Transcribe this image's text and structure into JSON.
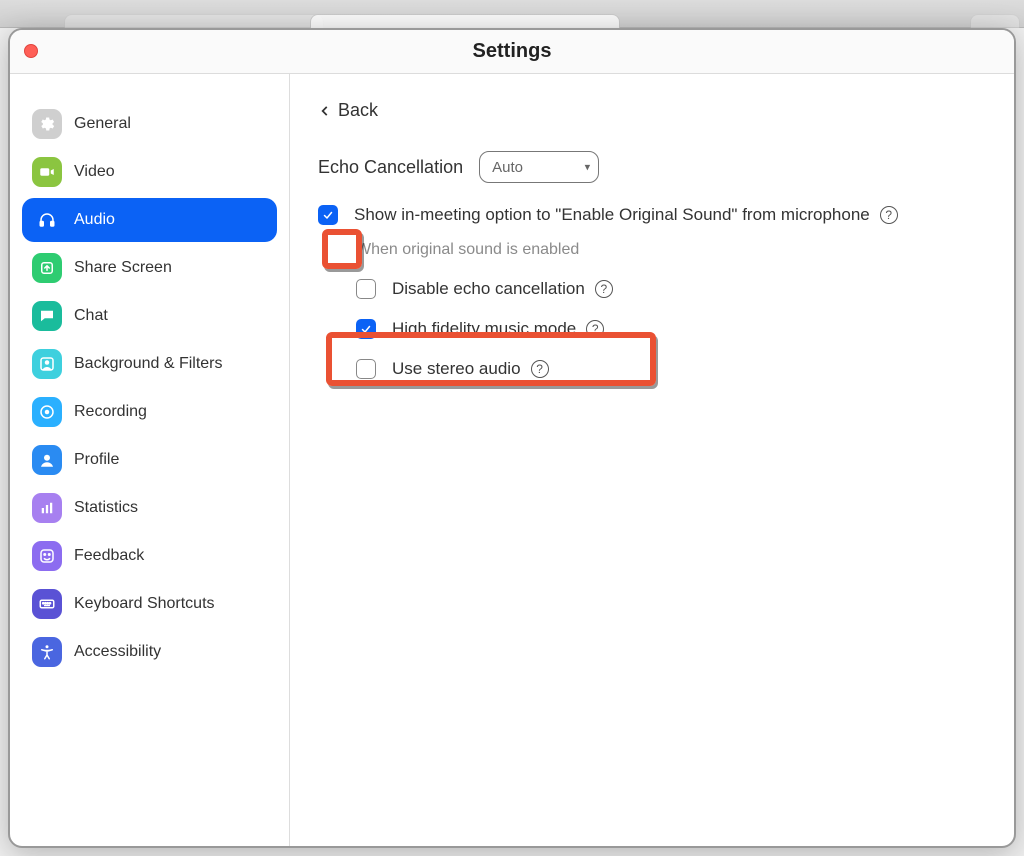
{
  "window": {
    "title": "Settings"
  },
  "sidebar": {
    "items": [
      {
        "label": "General"
      },
      {
        "label": "Video"
      },
      {
        "label": "Audio"
      },
      {
        "label": "Share Screen"
      },
      {
        "label": "Chat"
      },
      {
        "label": "Background & Filters"
      },
      {
        "label": "Recording"
      },
      {
        "label": "Profile"
      },
      {
        "label": "Statistics"
      },
      {
        "label": "Feedback"
      },
      {
        "label": "Keyboard Shortcuts"
      },
      {
        "label": "Accessibility"
      }
    ]
  },
  "content": {
    "back": "Back",
    "echo": {
      "label": "Echo Cancellation",
      "value": "Auto"
    },
    "show_original": {
      "label": "Show in-meeting option to \"Enable Original Sound\" from microphone",
      "checked": true
    },
    "orig_hint": "When original sound is enabled",
    "disable_echo": {
      "label": "Disable echo cancellation",
      "checked": false
    },
    "hifi": {
      "label": "High fidelity music mode",
      "checked": true
    },
    "stereo": {
      "label": "Use stereo audio",
      "checked": false
    }
  }
}
